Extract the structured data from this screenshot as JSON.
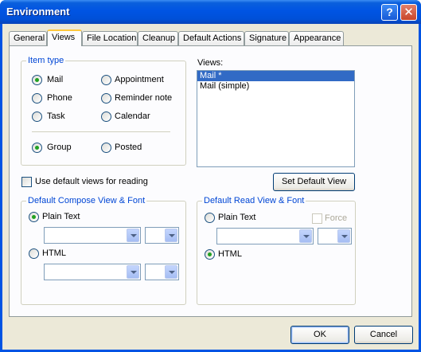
{
  "window": {
    "title": "Environment"
  },
  "titlebar": {
    "help_glyph": "?",
    "close_glyph": "✕"
  },
  "tabs": [
    {
      "label": "General",
      "active": false
    },
    {
      "label": "Views",
      "active": true
    },
    {
      "label": "File Location",
      "active": false
    },
    {
      "label": "Cleanup",
      "active": false
    },
    {
      "label": "Default Actions",
      "active": false
    },
    {
      "label": "Signature",
      "active": false
    },
    {
      "label": "Appearance",
      "active": false
    }
  ],
  "item_type": {
    "legend": "Item type",
    "options": [
      {
        "label": "Mail",
        "checked": true
      },
      {
        "label": "Appointment",
        "checked": false
      },
      {
        "label": "Phone",
        "checked": false
      },
      {
        "label": "Reminder note",
        "checked": false
      },
      {
        "label": "Task",
        "checked": false
      },
      {
        "label": "Calendar",
        "checked": false
      }
    ],
    "scope": [
      {
        "label": "Group",
        "checked": true
      },
      {
        "label": "Posted",
        "checked": false
      }
    ]
  },
  "views": {
    "label": "Views:",
    "items": [
      {
        "label": "Mail *",
        "selected": true
      },
      {
        "label": "Mail (simple)",
        "selected": false
      }
    ]
  },
  "use_default_views": {
    "label": "Use default views for reading",
    "checked": false
  },
  "set_default_view": {
    "label": "Set Default View"
  },
  "compose": {
    "legend": "Default Compose View & Font",
    "plain_text": {
      "label": "Plain Text",
      "checked": true
    },
    "html": {
      "label": "HTML",
      "checked": false
    },
    "font_value": "",
    "size_value": ""
  },
  "read": {
    "legend": "Default Read View & Font",
    "plain_text": {
      "label": "Plain Text",
      "checked": false
    },
    "html": {
      "label": "HTML",
      "checked": true
    },
    "force": {
      "label": "Force",
      "checked": false,
      "disabled": true
    },
    "font_value": "",
    "size_value": ""
  },
  "footer": {
    "ok": "OK",
    "cancel": "Cancel"
  }
}
